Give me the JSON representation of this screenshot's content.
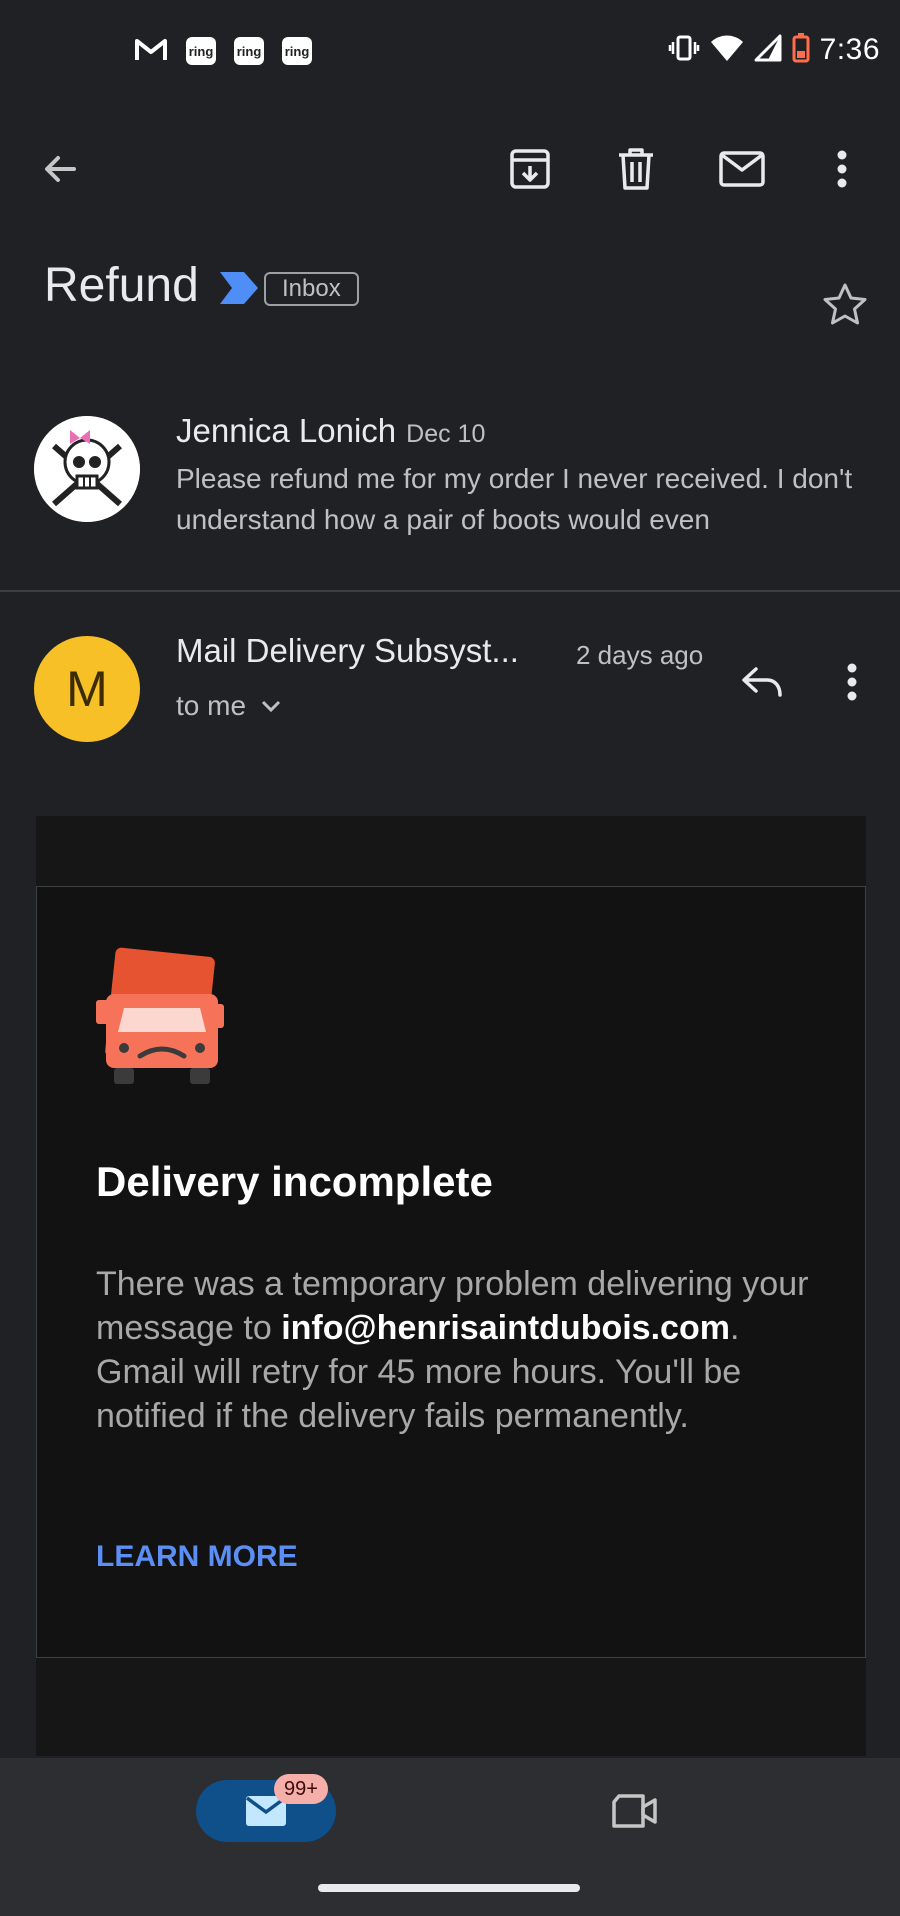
{
  "status_bar": {
    "time": "7:36",
    "notification_icons": [
      "gmail-icon",
      "ring-icon",
      "ring-icon",
      "ring-icon"
    ],
    "ring_label": "ring",
    "system_icons": [
      "vibrate-icon",
      "wifi-icon",
      "signal-icon",
      "battery-low-icon"
    ]
  },
  "toolbar": {
    "icons": [
      "back-arrow-icon",
      "archive-icon",
      "delete-icon",
      "mark-unread-icon",
      "more-vert-icon"
    ]
  },
  "thread": {
    "subject": "Refund",
    "label": "Inbox",
    "important_color": "#4f8ef7"
  },
  "message1": {
    "sender": "Jennica Lonich",
    "date": "Dec 10",
    "snippet": "Please refund me for my order I never received. I don't understand how a pair of boots would even"
  },
  "message2": {
    "avatar_letter": "M",
    "avatar_color": "#f6c026",
    "sender": "Mail Delivery Subsyst...",
    "time": "2 days ago",
    "recipient": "to me"
  },
  "bounce_card": {
    "title": "Delivery incomplete",
    "text_before": "There was a temporary problem delivering your message to ",
    "email": "info@henrisaintdubois.com",
    "text_after": ". Gmail will retry for 45 more hours. You'll be notified if the delivery fails permanently.",
    "link": "LEARN MORE",
    "link_color": "#5b8ff5"
  },
  "bottom_nav": {
    "mail_badge": "99+",
    "items": [
      "mail-icon",
      "meet-video-icon"
    ]
  }
}
